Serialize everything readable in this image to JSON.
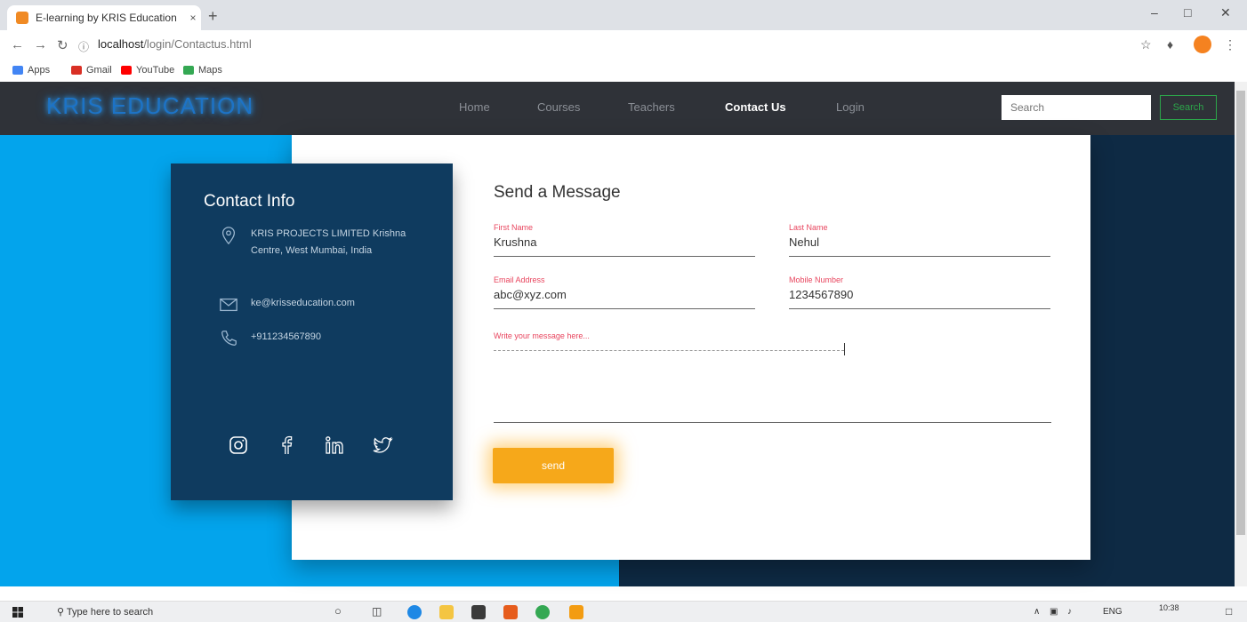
{
  "browser": {
    "tab_title": "E-learning by KRIS Education",
    "tab_close": "×",
    "new_tab": "+",
    "url_host": "localhost",
    "url_path": "/login/Contactus.html",
    "bookmarks": [
      "Apps",
      "Gmail",
      "YouTube",
      "Maps"
    ]
  },
  "site": {
    "brand": "KRIS EDUCATION",
    "nav": [
      "Home",
      "Courses",
      "Teachers",
      "Contact Us",
      "Login"
    ],
    "active_nav": "Contact Us",
    "search_placeholder": "Search",
    "search_button": "Search"
  },
  "contact_info": {
    "title": "Contact Info",
    "address": "KRIS PROJECTS LIMITED Krishna Centre, West Mumbai, India",
    "email": "ke@krisseducation.com",
    "phone": "+911234567890",
    "socials": [
      "instagram-icon",
      "facebook-icon",
      "linkedin-icon",
      "twitter-icon"
    ]
  },
  "form": {
    "title": "Send a Message",
    "first_name_label": "First Name",
    "first_name_value": "Krushna",
    "last_name_label": "Last Name",
    "last_name_value": "Nehul",
    "email_label": "Email Address",
    "email_value": "abc@xyz.com",
    "mobile_label": "Mobile Number",
    "mobile_value": "1234567890",
    "message_placeholder": "Write your message here...",
    "send_label": "send"
  },
  "taskbar": {
    "search_placeholder": "Type here to search",
    "language": "ENG",
    "time": "10:38"
  },
  "colors": {
    "header_bg": "#2f3238",
    "left_bg": "#03a4ec",
    "right_bg": "#0e2a44",
    "info_bg": "#0f3b5f",
    "accent_label": "#e8455e",
    "send_button": "#f6a81a",
    "search_button_border": "#2ca64a"
  }
}
